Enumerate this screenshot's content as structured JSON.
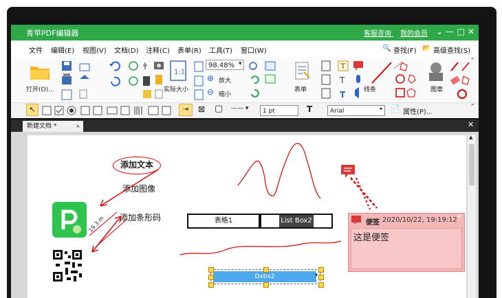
{
  "app": {
    "title": "青苹PDF编辑器",
    "support_link": "客服咨询",
    "account_link": "我的会员"
  },
  "menu": [
    "文件",
    "编辑(E)",
    "视图(V)",
    "文档(D)",
    "注释(C)",
    "表单(R)",
    "工具(T)",
    "窗口(W)"
  ],
  "menu_right": {
    "find": "查找(F)",
    "advanced_find": "高级查找(S)"
  },
  "ribbon": {
    "open": "打开(O)...",
    "actual_size": "实际大小",
    "zoom_value": "98.48%",
    "zoom_in": "放大",
    "zoom_out": "缩小",
    "form": "表单",
    "line": "线条",
    "stamp": "图章"
  },
  "toolbar2": {
    "line_width": "1 pt",
    "font": "Arial",
    "properties": "属性(P)..."
  },
  "tab": {
    "name": "新建文档 *"
  },
  "document": {
    "oval_text": "添加文本",
    "image_label": "添加图像",
    "barcode_label": "添加条形码",
    "measure": "19.3 m",
    "table_cell": "表格1",
    "listbox": "List Box2",
    "combo": "Dxbx2"
  },
  "note": {
    "author": "便签",
    "date": "2020/10/22, 19:19:12",
    "content": "这是便签"
  },
  "colors": {
    "titlebar": "#2fa84a",
    "annotation_red": "#dd0000",
    "note_bg": "#f2b8b8"
  }
}
